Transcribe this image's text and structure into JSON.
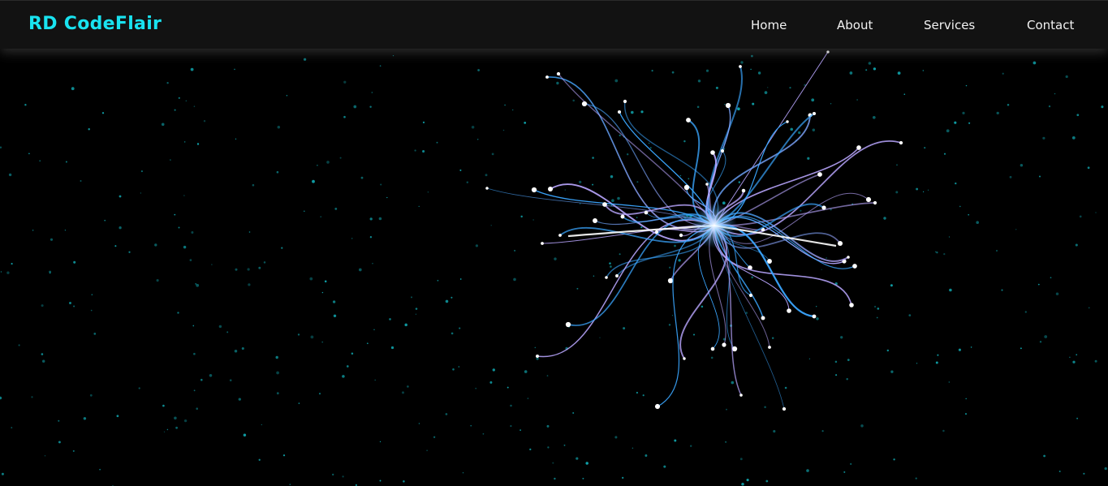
{
  "brand": {
    "name": "RD CodeFlair"
  },
  "nav": {
    "items": [
      {
        "label": "Home"
      },
      {
        "label": "About"
      },
      {
        "label": "Services"
      },
      {
        "label": "Contact"
      }
    ]
  },
  "colors": {
    "background": "#000000",
    "navbar": "#121212",
    "brand": "#19e3f0",
    "nav_text": "#f2f2f2",
    "star": "#10a8b0",
    "strand_cyan": "#3aa6ff",
    "strand_violet": "#b9a6ff",
    "strand_core": "#ffffff"
  }
}
